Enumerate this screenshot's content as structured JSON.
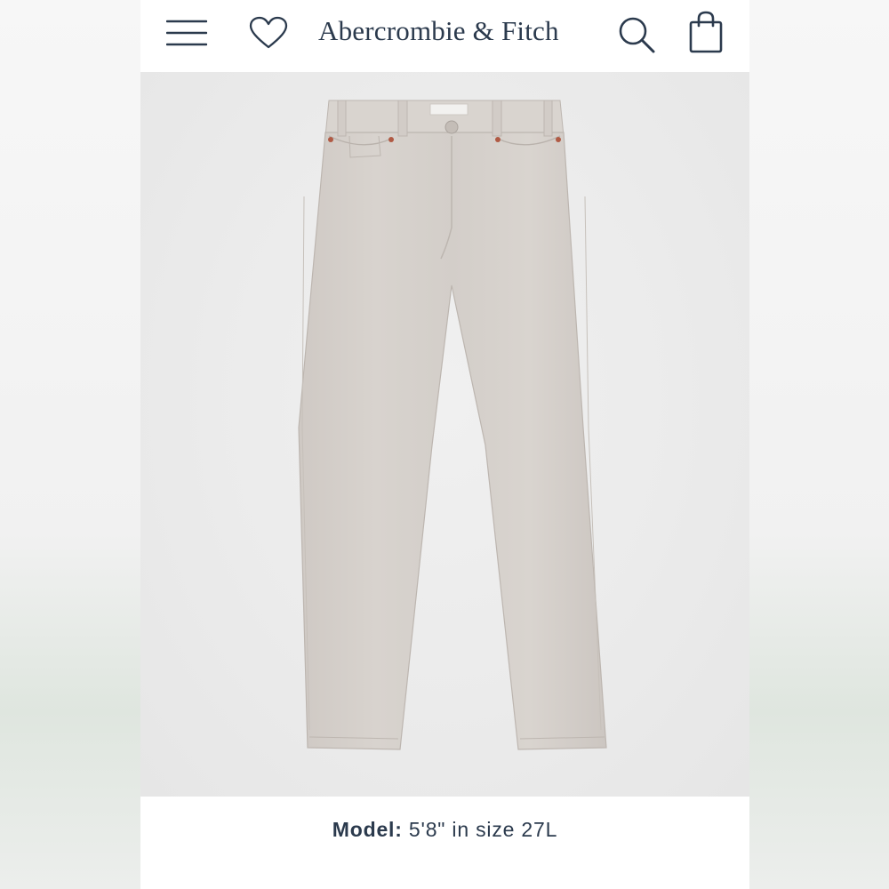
{
  "header": {
    "brand": "Abercrombie & Fitch",
    "icons": [
      "menu-icon",
      "heart-icon",
      "search-icon",
      "shopping-bag-icon"
    ]
  },
  "product": {
    "image_icon": "product-image-jeans",
    "image_color": "#d6d1cc"
  },
  "caption": {
    "label": "Model:",
    "value": "5'8\" in size 27L"
  },
  "colors": {
    "brand_navy": "#2b3a4d",
    "background": "#ffffff"
  }
}
